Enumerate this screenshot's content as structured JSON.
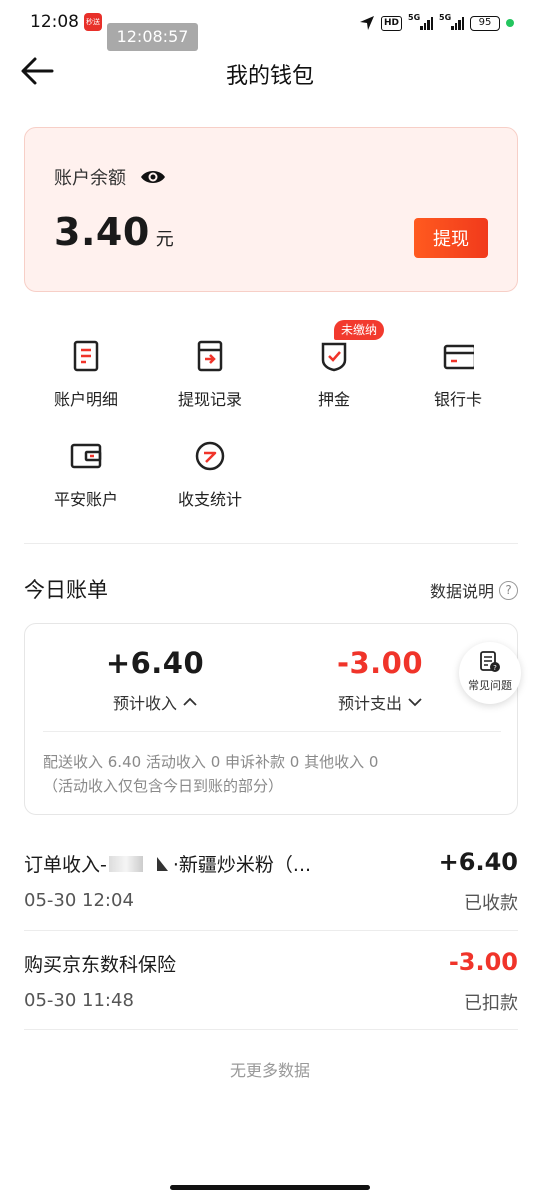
{
  "status_bar": {
    "time": "12:08",
    "app_badge": "秒送",
    "clock_overlay": "12:08:57",
    "hd_label": "HD",
    "network_1": "5G",
    "network_2": "5G",
    "battery": "95"
  },
  "header": {
    "title": "我的钱包",
    "back_icon": "arrow-left-icon"
  },
  "balance": {
    "label": "账户余额",
    "amount": "3.40",
    "unit": "元",
    "withdraw_label": "提现",
    "accent_color": "#f13a1c"
  },
  "grid_items": [
    {
      "label": "账户明细",
      "icon": "document-icon"
    },
    {
      "label": "提现记录",
      "icon": "withdraw-record-icon"
    },
    {
      "label": "押金",
      "icon": "shield-check-icon",
      "badge": "未缴纳"
    },
    {
      "label": "银行卡",
      "icon": "bank-card-icon"
    },
    {
      "label": "平安账户",
      "icon": "wallet-icon"
    },
    {
      "label": "收支统计",
      "icon": "gauge-icon"
    }
  ],
  "today": {
    "title": "今日账单",
    "data_desc": "数据说明",
    "income_value": "+6.40",
    "income_label": "预计收入",
    "expense_value": "-3.00",
    "expense_label": "预计支出",
    "detail_line1": "配送收入 6.40 活动收入 0 申诉补款 0 其他收入 0",
    "detail_line2": "（活动收入仅包含今日到账的部分）",
    "faq_label": "常见问题"
  },
  "transactions": [
    {
      "title_prefix": "订单收入-",
      "title_suffix": "·新疆炒米粉（...",
      "time": "05-30 12:04",
      "amount": "+6.40",
      "status": "已收款"
    },
    {
      "title_prefix": "购买京东数科保险",
      "title_suffix": "",
      "time": "05-30 11:48",
      "amount": "-3.00",
      "status": "已扣款"
    }
  ],
  "footer": {
    "no_more": "无更多数据"
  }
}
